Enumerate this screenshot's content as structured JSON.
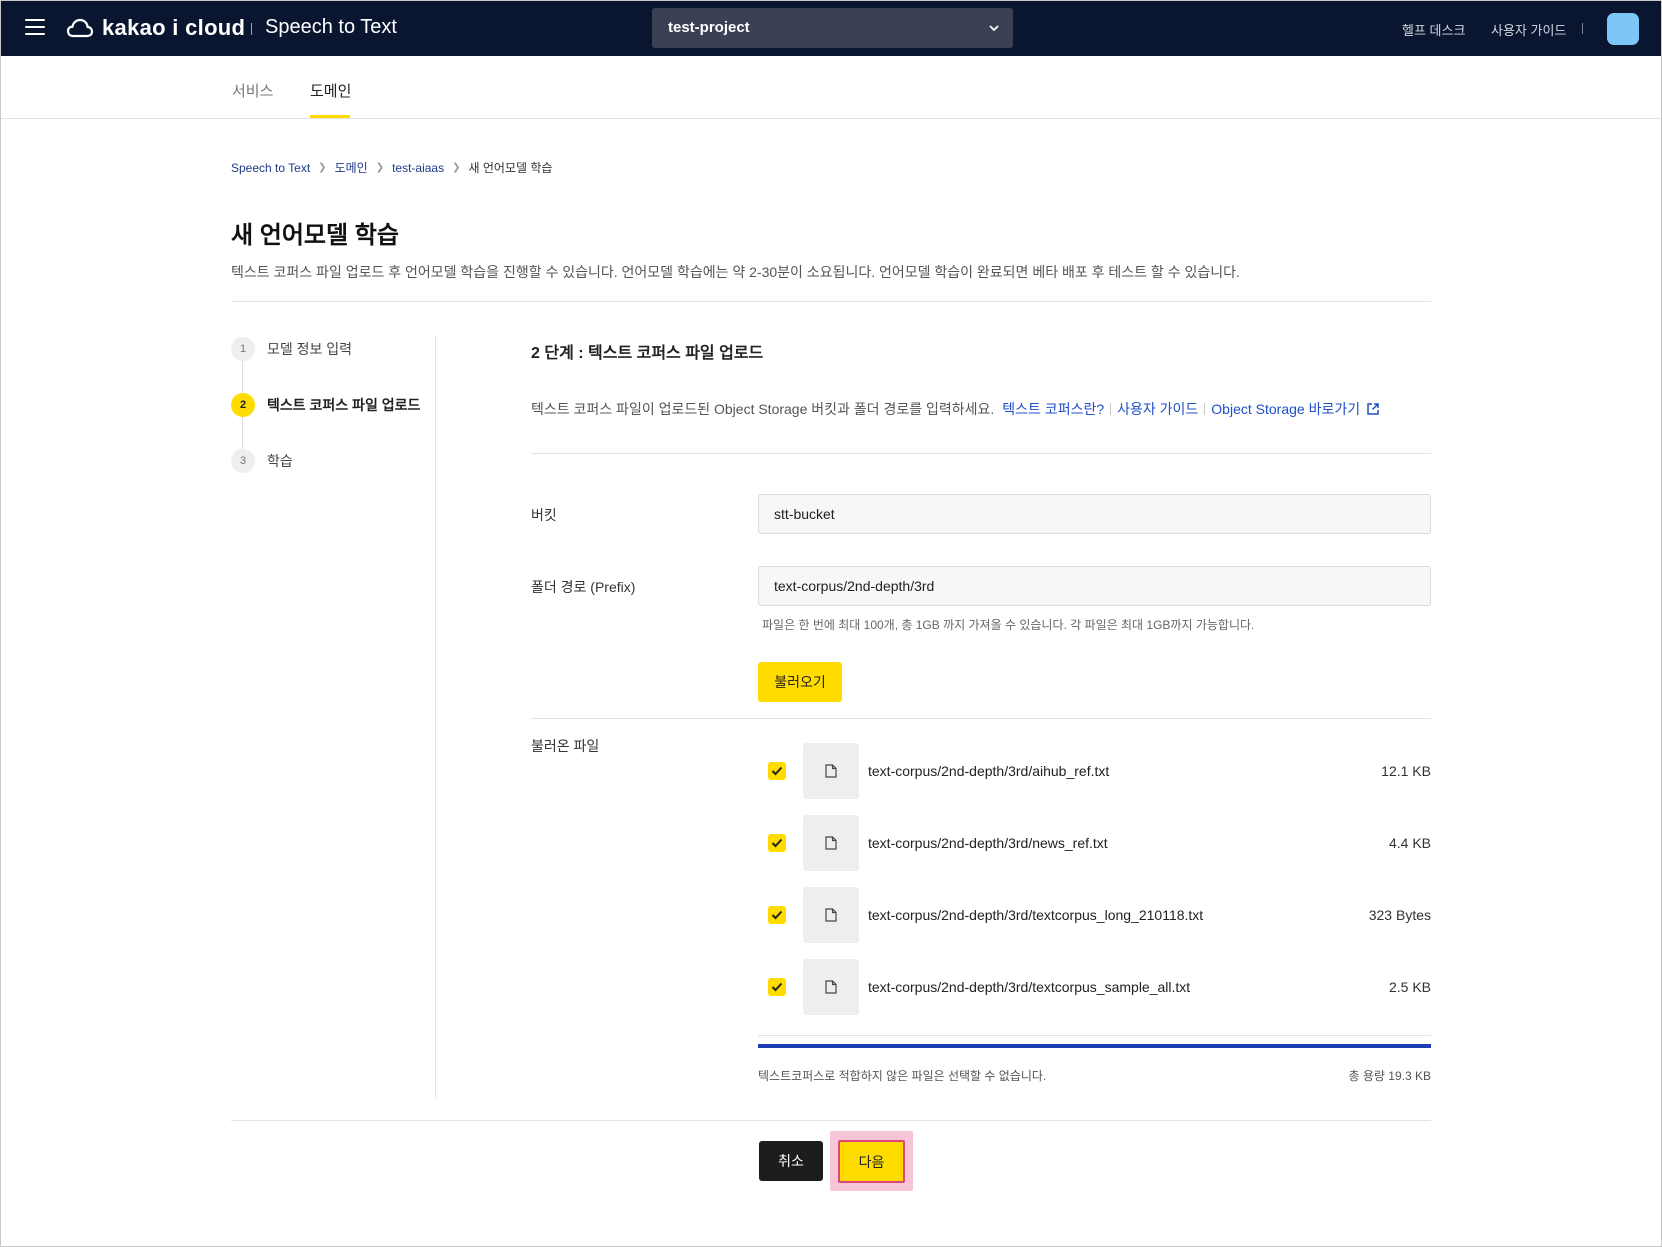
{
  "header": {
    "logo_text": "kakao i cloud",
    "app_title": "Speech to Text",
    "project": "test-project",
    "links": [
      "헬프 데스크",
      "사용자 가이드"
    ]
  },
  "tabs": [
    {
      "label": "서비스",
      "active": false
    },
    {
      "label": "도메인",
      "active": true
    }
  ],
  "breadcrumb": [
    "Speech to Text",
    "도메인",
    "test-aiaas",
    "새 언어모델 학습"
  ],
  "page": {
    "title": "새 언어모델 학습",
    "description": "텍스트 코퍼스 파일 업로드 후 언어모델 학습을 진행할 수 있습니다. 언어모델 학습에는 약 2-30분이 소요됩니다. 언어모델 학습이 완료되면 베타 배포 후 테스트 할 수 있습니다."
  },
  "steps": [
    {
      "num": "1",
      "label": "모델 정보 입력"
    },
    {
      "num": "2",
      "label": "텍스트 코퍼스 파일 업로드"
    },
    {
      "num": "3",
      "label": "학습"
    }
  ],
  "content": {
    "step_title": "2 단계 : 텍스트 코퍼스 파일 업로드",
    "desc": "텍스트 코퍼스 파일이 업로드된 Object Storage 버킷과 폴더 경로를 입력하세요.",
    "link1": "텍스트 코퍼스란?",
    "link2": "사용자 가이드",
    "link3": "Object Storage 바로가기",
    "bucket_label": "버킷",
    "bucket_value": "stt-bucket",
    "prefix_label": "폴더 경로 (Prefix)",
    "prefix_value": "text-corpus/2nd-depth/3rd",
    "help": "파일은 한 번에 최대 100개, 총 1GB 까지 가져올 수 있습니다. 각 파일은 최대 1GB까지 가능합니다.",
    "load_button": "불러오기",
    "files_label": "불러온 파일",
    "files": [
      {
        "name": "text-corpus/2nd-depth/3rd/aihub_ref.txt",
        "size": "12.1 KB",
        "checked": true
      },
      {
        "name": "text-corpus/2nd-depth/3rd/news_ref.txt",
        "size": "4.4 KB",
        "checked": true
      },
      {
        "name": "text-corpus/2nd-depth/3rd/textcorpus_long_210118.txt",
        "size": "323 Bytes",
        "checked": true
      },
      {
        "name": "text-corpus/2nd-depth/3rd/textcorpus_sample_all.txt",
        "size": "2.5 KB",
        "checked": true
      }
    ],
    "foot_note": "텍스트코퍼스로 적합하지 않은 파일은 선택할 수 없습니다.",
    "total": "총 용량 19.3 KB"
  },
  "actions": {
    "cancel": "취소",
    "next": "다음"
  },
  "colors": {
    "topbar": "#0a1530",
    "accent": "#fedc00",
    "link": "#1f4fc8",
    "progress": "#1f3eb6",
    "highlight": "#e0457a"
  },
  "icons": [
    "menu-icon",
    "cloud-logo-icon",
    "chevron-down-icon",
    "external-link-icon",
    "file-icon",
    "check-icon"
  ]
}
